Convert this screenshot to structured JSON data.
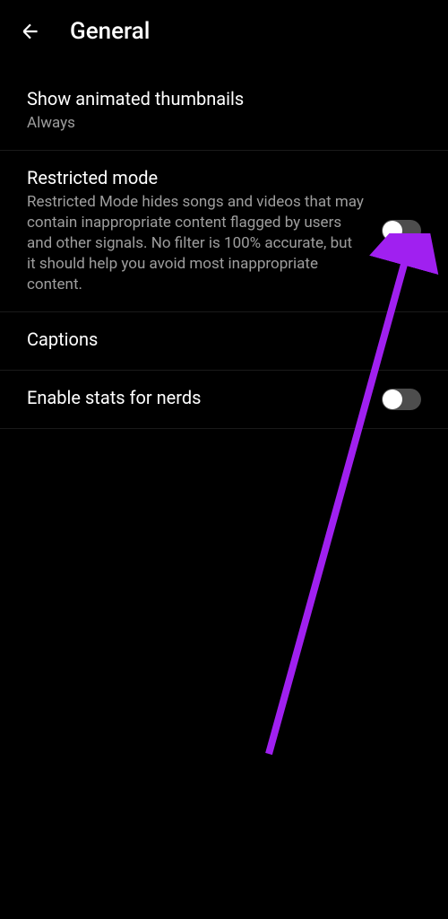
{
  "header": {
    "title": "General"
  },
  "settings": {
    "animated_thumbnails": {
      "title": "Show animated thumbnails",
      "subtitle": "Always"
    },
    "restricted_mode": {
      "title": "Restricted mode",
      "subtitle": "Restricted Mode hides songs and videos that may contain inappropriate content flagged by users and other signals. No filter is 100% accurate, but it should help you avoid most inappropriate content."
    },
    "captions": {
      "title": "Captions"
    },
    "stats_for_nerds": {
      "title": "Enable stats for nerds"
    }
  },
  "annotation": {
    "color": "#a020f0"
  }
}
